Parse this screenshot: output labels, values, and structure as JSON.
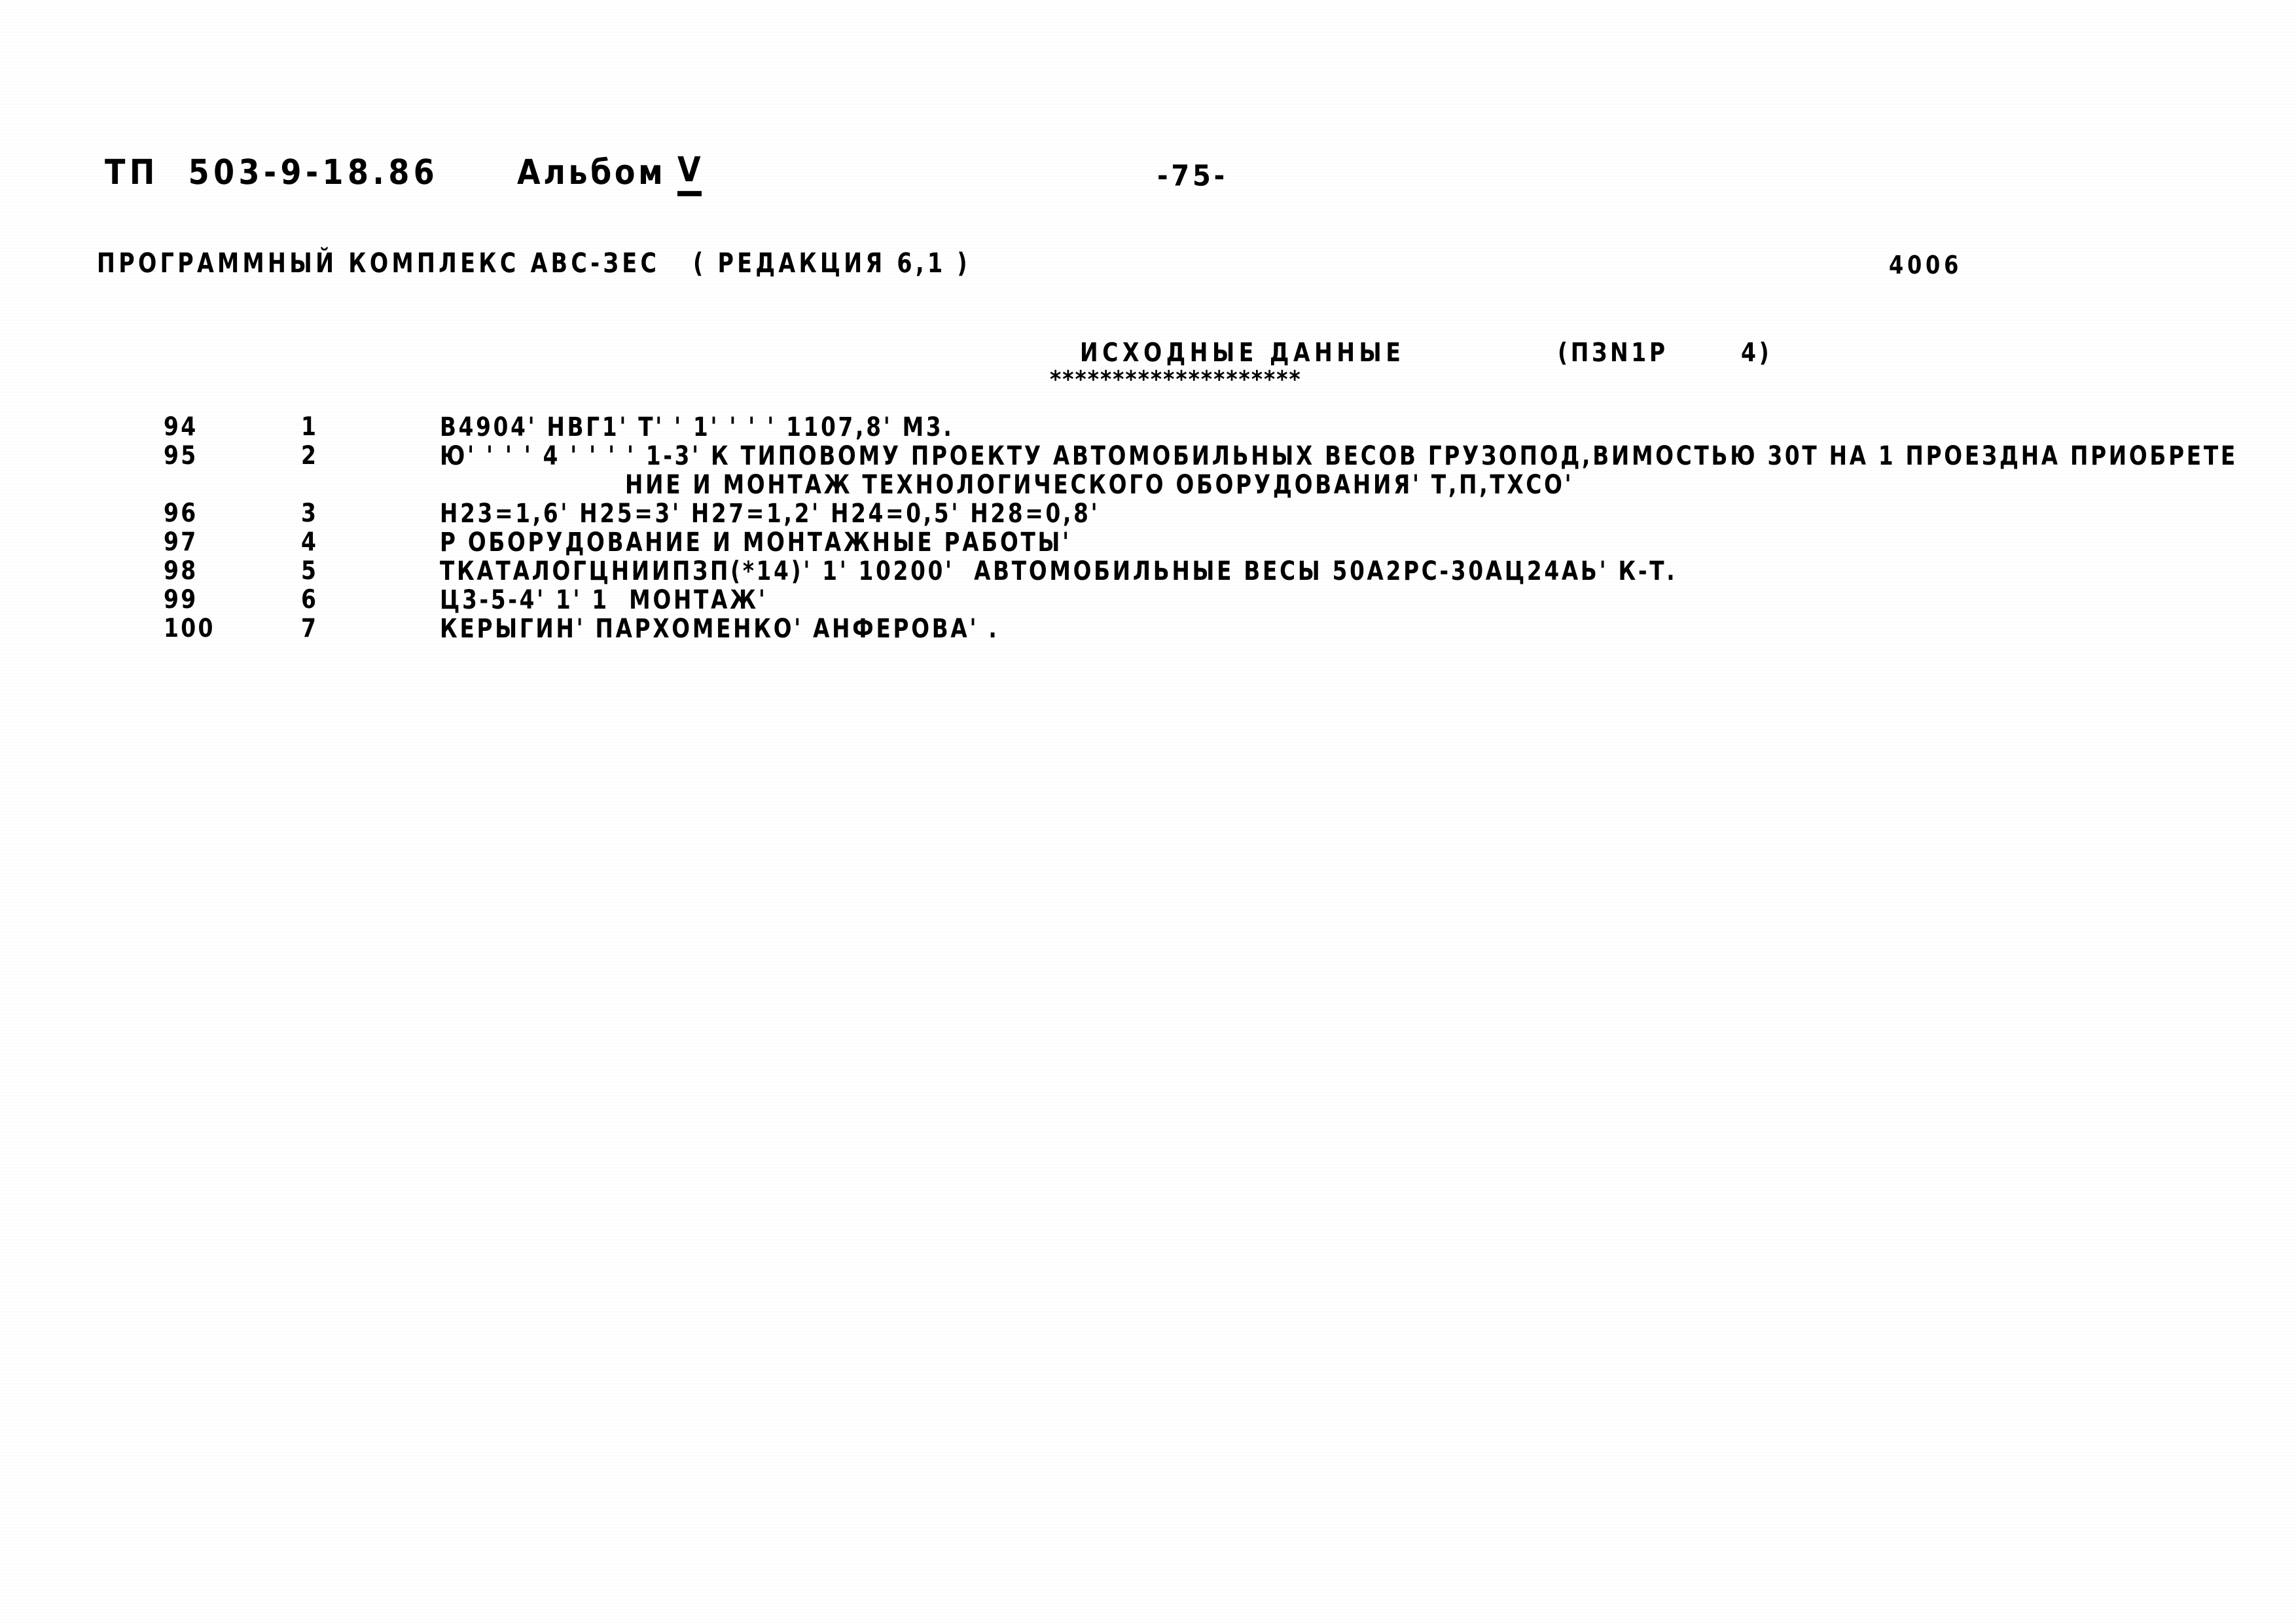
{
  "header": {
    "doc_code": "ТП  503-9-18.86",
    "album_label": "Альбом",
    "album_volume": "V",
    "page_number": "-75-"
  },
  "banner": {
    "complex_line": "ПРОГРАММНЫЙ КОМПЛЕКС АВС-ЗЕС   ( РЕДАКЦИЯ 6,1 )",
    "job_number": "4006"
  },
  "section": {
    "title": "ИСХОДНЫЕ ДАННЫЕ",
    "rule": "********************",
    "ref": "(ПЗN1P",
    "ref_number": "4)"
  },
  "listing": {
    "rows": [
      {
        "line_no": "94",
        "seq_no": "1",
        "text": "В4904' НВГ1' Т' ' 1' ' ' ' 1107,8' М3."
      },
      {
        "line_no": "95",
        "seq_no": "2",
        "text": "Ю' ' ' ' 4 ' ' ' ' 1-3' К ТИПОВОМУ ПРОЕКТУ АВТОМОБИЛЬНЫХ ВЕСОВ ГРУЗОПОД,ВИМОСТЬЮ 30Т НА 1 ПРОЕЗДНА ПРИОБРЕТЕ",
        "cont": "НИЕ И МОНТАЖ ТЕХНОЛОГИЧЕСКОГО ОБОРУДОВАНИЯ' Т,П,ТХСО'"
      },
      {
        "line_no": "96",
        "seq_no": "3",
        "text": "Н23=1,6' Н25=3' Н27=1,2' Н24=0,5' Н28=0,8'"
      },
      {
        "line_no": "97",
        "seq_no": "4",
        "text": "Р ОБОРУДОВАНИЕ И МОНТАЖНЫЕ РАБОТЫ'"
      },
      {
        "line_no": "98",
        "seq_no": "5",
        "text": "ТКАТАЛОГЦНИИПЗП(*14)' 1' 10200'  АВТОМОБИЛЬНЫЕ ВЕСЫ 50А2РС-30АЦ24АЬ' К-Т."
      },
      {
        "line_no": "99",
        "seq_no": "6",
        "text": "Ц3-5-4' 1' 1  МОНТАЖ'"
      },
      {
        "line_no": "100",
        "seq_no": "7",
        "text": "КЕРЫГИН' ПАРХОМЕНКО' АНФЕРОВА' ."
      }
    ]
  }
}
